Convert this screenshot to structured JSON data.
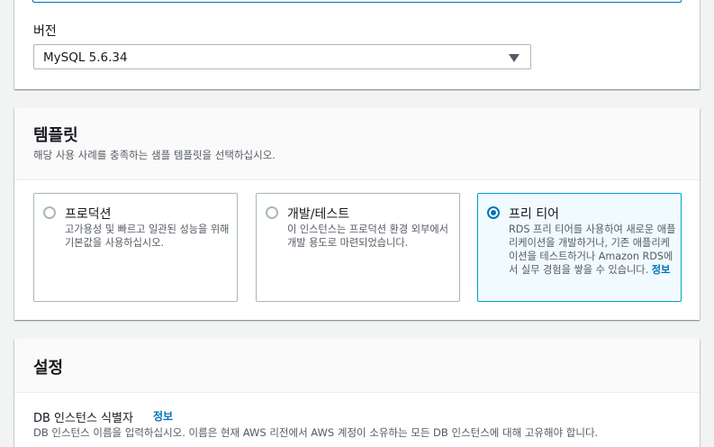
{
  "engine_version": {
    "label": "버전",
    "selected": "MySQL 5.6.34"
  },
  "templates": {
    "title": "템플릿",
    "description": "해당 사용 사례를 충족하는 샘플 템플릿을 선택하십시오.",
    "options": [
      {
        "label": "프로덕션",
        "description": "고가용성 및 빠르고 일관된 성능을 위해 기본값을 사용하십시오.",
        "selected": false
      },
      {
        "label": "개발/테스트",
        "description": "이 인스턴스는 프로덕션 환경 외부에서 개발 용도로 마련되었습니다.",
        "selected": false
      },
      {
        "label": "프리 티어",
        "description": "RDS 프리 티어를 사용하여 새로운 애플리케이션을 개발하거나, 기존 애플리케이션을 테스트하거나 Amazon RDS에서 실무 경험을 쌓을 수 있습니다.",
        "info_link": "정보",
        "selected": true
      }
    ]
  },
  "settings": {
    "title": "설정",
    "db_identifier_label": "DB 인스턴스 식별자",
    "db_identifier_info": "정보",
    "db_identifier_desc": "DB 인스턴스 이름을 입력하십시오. 이름은 현재 AWS 리전에서 AWS 계정이 소유하는 모든 DB 인스턴스에 대해 고유해야 합니다."
  },
  "colors": {
    "accent": "#0073bb",
    "selected_border": "#00a1c9",
    "selected_bg": "#f1faff"
  }
}
